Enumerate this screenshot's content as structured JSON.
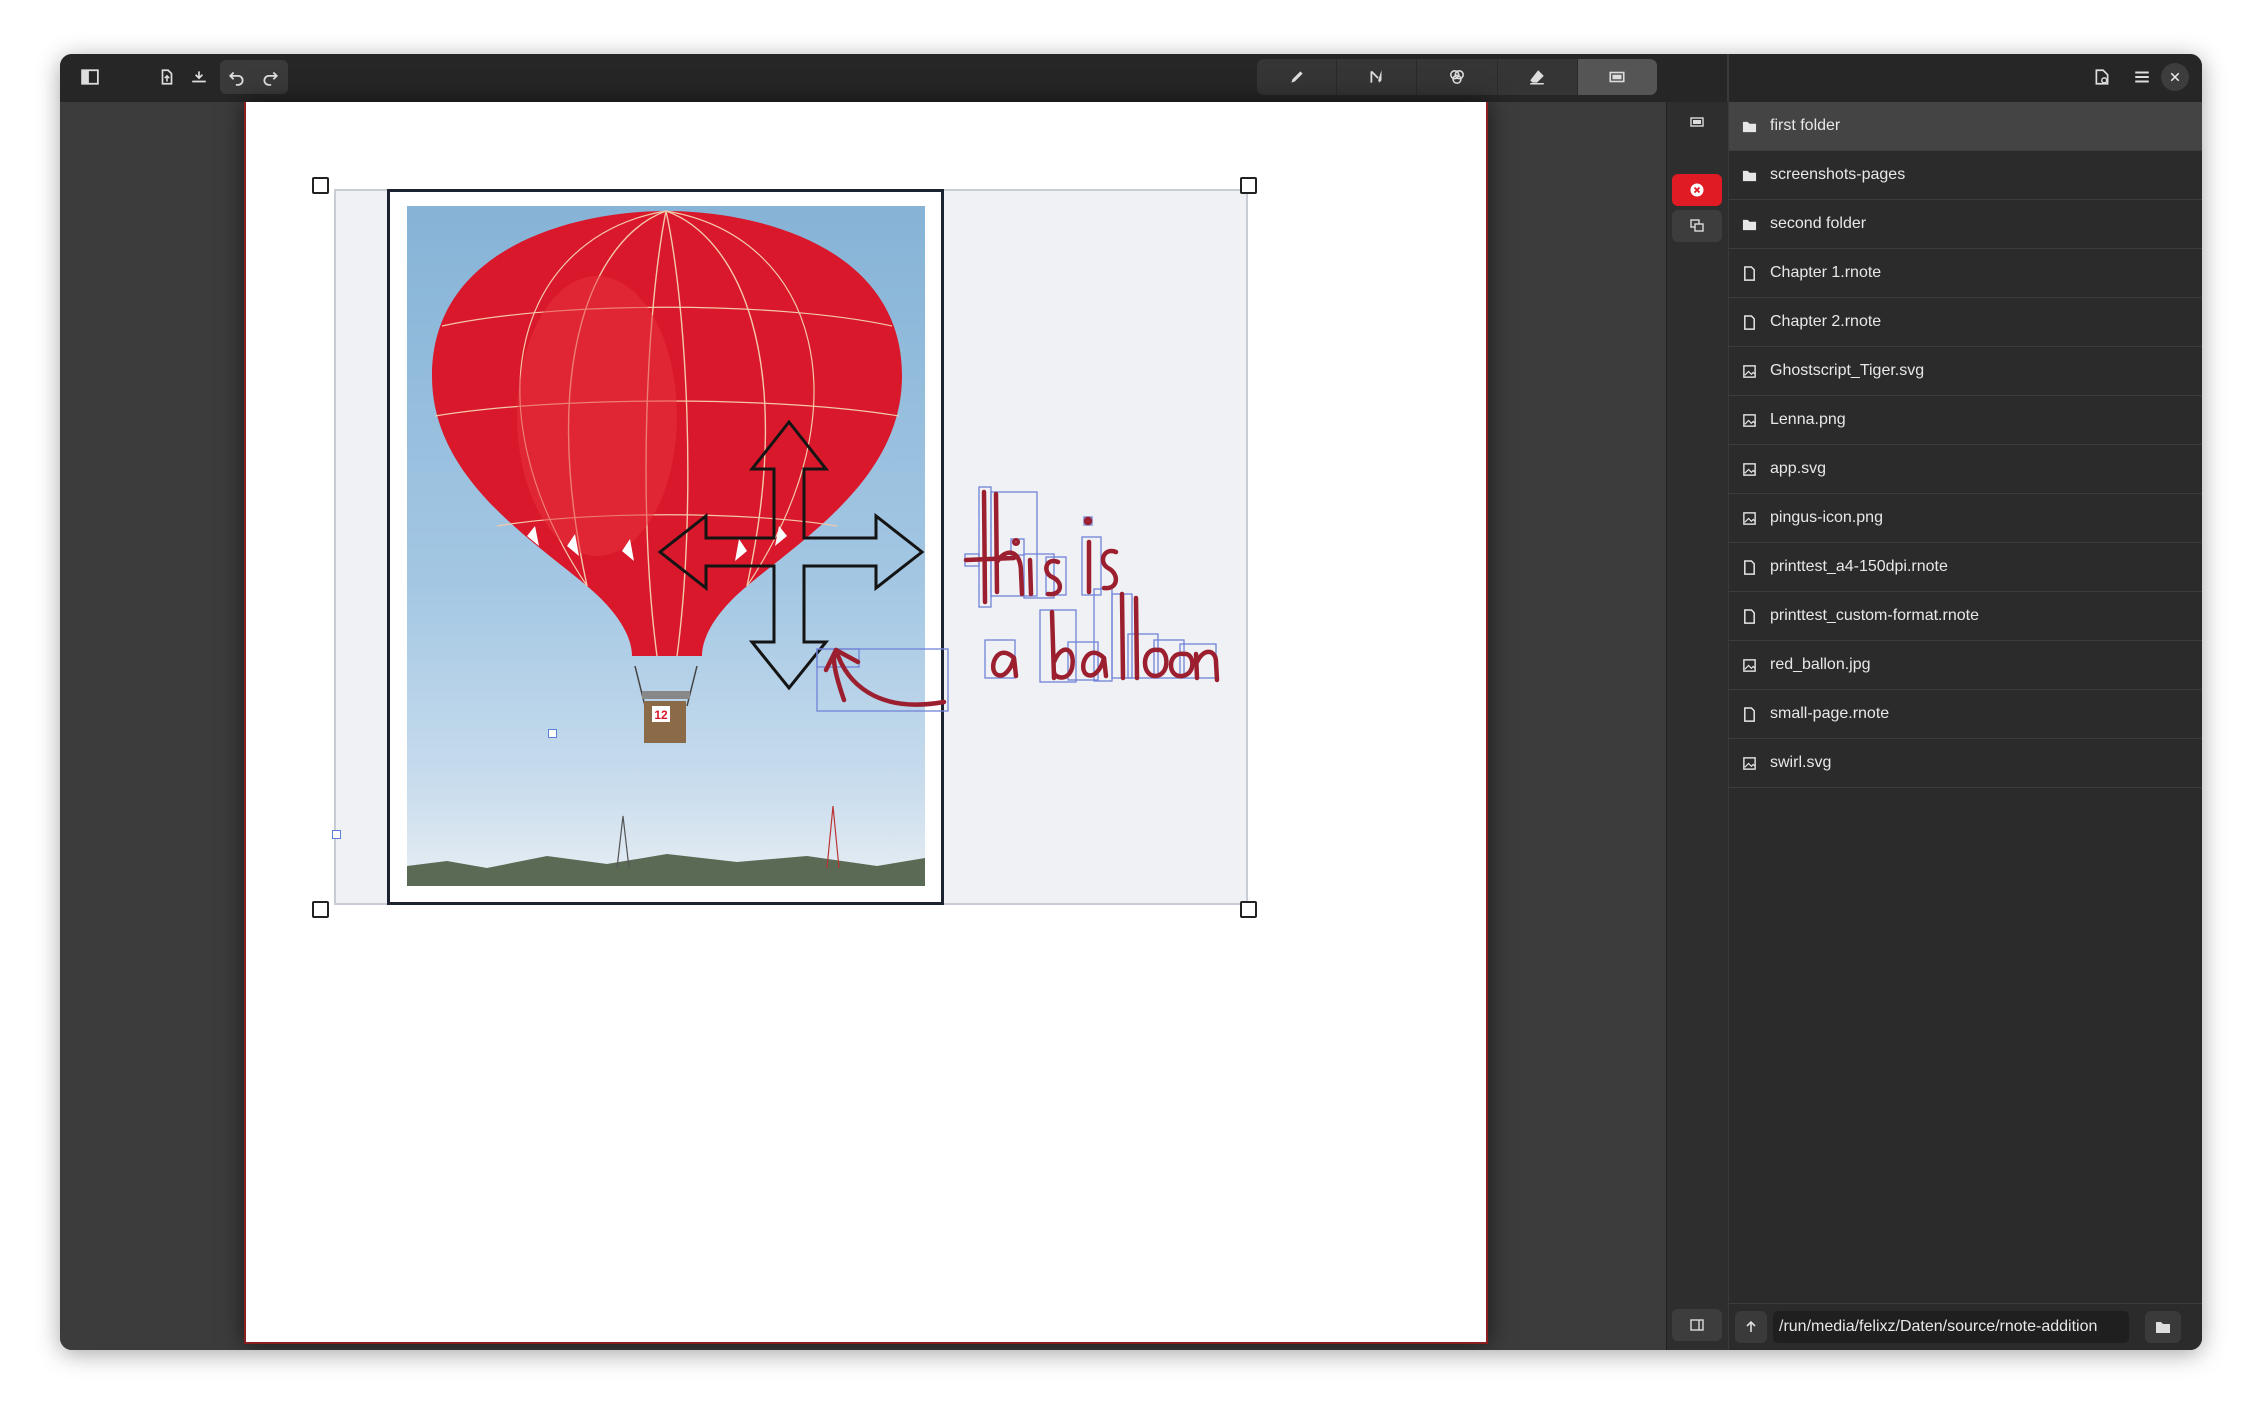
{
  "header": {
    "left_buttons": [
      "sidebar-toggle-icon",
      "export-icon",
      "import-icon",
      "undo-icon",
      "redo-icon"
    ],
    "tools": [
      {
        "name": "pen-icon",
        "active": false
      },
      {
        "name": "shaper-icon",
        "active": false
      },
      {
        "name": "typewriter-icon",
        "active": false
      },
      {
        "name": "eraser-icon",
        "active": false
      },
      {
        "name": "selector-icon",
        "active": true
      }
    ],
    "right_buttons": [
      "new-document-icon",
      "menu-icon",
      "close-icon"
    ]
  },
  "canvas": {
    "handwriting_line1": "this is",
    "handwriting_line2": "a balloon",
    "image_badge": "12",
    "ink_color": "#9b1f2e",
    "accent_color": "#e01b24"
  },
  "mini_sidebar": {
    "buttons": [
      "selector-mode-icon",
      "delete-selection-icon",
      "duplicate-selection-icon",
      "panel-toggle-icon"
    ]
  },
  "file_browser": {
    "items": [
      {
        "label": "first folder",
        "type": "folder",
        "selected": true
      },
      {
        "label": "screenshots-pages",
        "type": "folder"
      },
      {
        "label": "second folder",
        "type": "folder"
      },
      {
        "label": "Chapter 1.rnote",
        "type": "document"
      },
      {
        "label": "Chapter 2.rnote",
        "type": "document"
      },
      {
        "label": "Ghostscript_Tiger.svg",
        "type": "image"
      },
      {
        "label": "Lenna.png",
        "type": "image"
      },
      {
        "label": "app.svg",
        "type": "image"
      },
      {
        "label": "pingus-icon.png",
        "type": "image"
      },
      {
        "label": "printtest_a4-150dpi.rnote",
        "type": "document"
      },
      {
        "label": "printtest_custom-format.rnote",
        "type": "document"
      },
      {
        "label": "red_ballon.jpg",
        "type": "image"
      },
      {
        "label": "small-page.rnote",
        "type": "document"
      },
      {
        "label": "swirl.svg",
        "type": "image"
      }
    ],
    "path": "/run/media/felixz/Daten/source/rnote-addition"
  }
}
